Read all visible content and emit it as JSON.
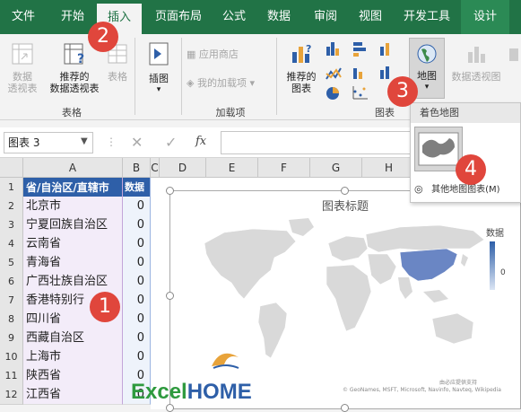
{
  "tabs": [
    {
      "label": "文件"
    },
    {
      "label": "开始"
    },
    {
      "label": "插入"
    },
    {
      "label": "页面布局"
    },
    {
      "label": "公式"
    },
    {
      "label": "数据"
    },
    {
      "label": "审阅"
    },
    {
      "label": "视图"
    },
    {
      "label": "开发工具"
    },
    {
      "label": "设计"
    }
  ],
  "ribbon": {
    "pivot_rec_line1": "数据",
    "pivot_rec_line2": "透视表",
    "rec_pivot_line1": "推荐的",
    "rec_pivot_line2": "数据透视表",
    "table_label": "表格",
    "group_tables": "表格",
    "illustrations": "插图",
    "app_store": "应用商店",
    "my_addins": "我的加载项",
    "group_addins": "加载项",
    "rec_charts_line1": "推荐的",
    "rec_charts_line2": "图表",
    "map_label": "地图",
    "pivot_chart": "数据透视图",
    "group_charts": "图表"
  },
  "dropdown": {
    "header": "着色地图",
    "more": "其他地图图表(M)"
  },
  "formula_bar": {
    "name_box": "图表 3",
    "fx": "fx"
  },
  "columns": [
    "A",
    "B",
    "C",
    "D",
    "E",
    "F",
    "G",
    "H"
  ],
  "table": {
    "header_a": "省/自治区/直辖市",
    "header_b": "数据",
    "rows": [
      {
        "num": "1"
      },
      {
        "num": "2",
        "name": "北京市",
        "val": "0"
      },
      {
        "num": "3",
        "name": "宁夏回族自治区",
        "val": "0"
      },
      {
        "num": "4",
        "name": "云南省",
        "val": "0"
      },
      {
        "num": "5",
        "name": "青海省",
        "val": "0"
      },
      {
        "num": "6",
        "name": "广西壮族自治区",
        "val": "0"
      },
      {
        "num": "7",
        "name": "香港特别行",
        "val": "0"
      },
      {
        "num": "8",
        "name": "四川省",
        "val": "0"
      },
      {
        "num": "9",
        "name": "西藏自治区",
        "val": "0"
      },
      {
        "num": "10",
        "name": "上海市",
        "val": "0"
      },
      {
        "num": "11",
        "name": "陕西省",
        "val": "0"
      },
      {
        "num": "12",
        "name": "江西省",
        "val": "0"
      }
    ]
  },
  "chart": {
    "title": "图表标题",
    "legend_title": "数据",
    "legend_value": "0",
    "credit": "由必应提供支持",
    "copyright": "© GeoNames, MSFT, Microsoft, Navinfo, Navteq, Wikipedia"
  },
  "watermark": {
    "excel": "Excel",
    "home": "HOME"
  },
  "callouts": [
    "1",
    "2",
    "3",
    "4"
  ],
  "colors": {
    "accent": "#217346",
    "header_blue": "#2e5fa8",
    "callout_red": "#e0463c"
  }
}
